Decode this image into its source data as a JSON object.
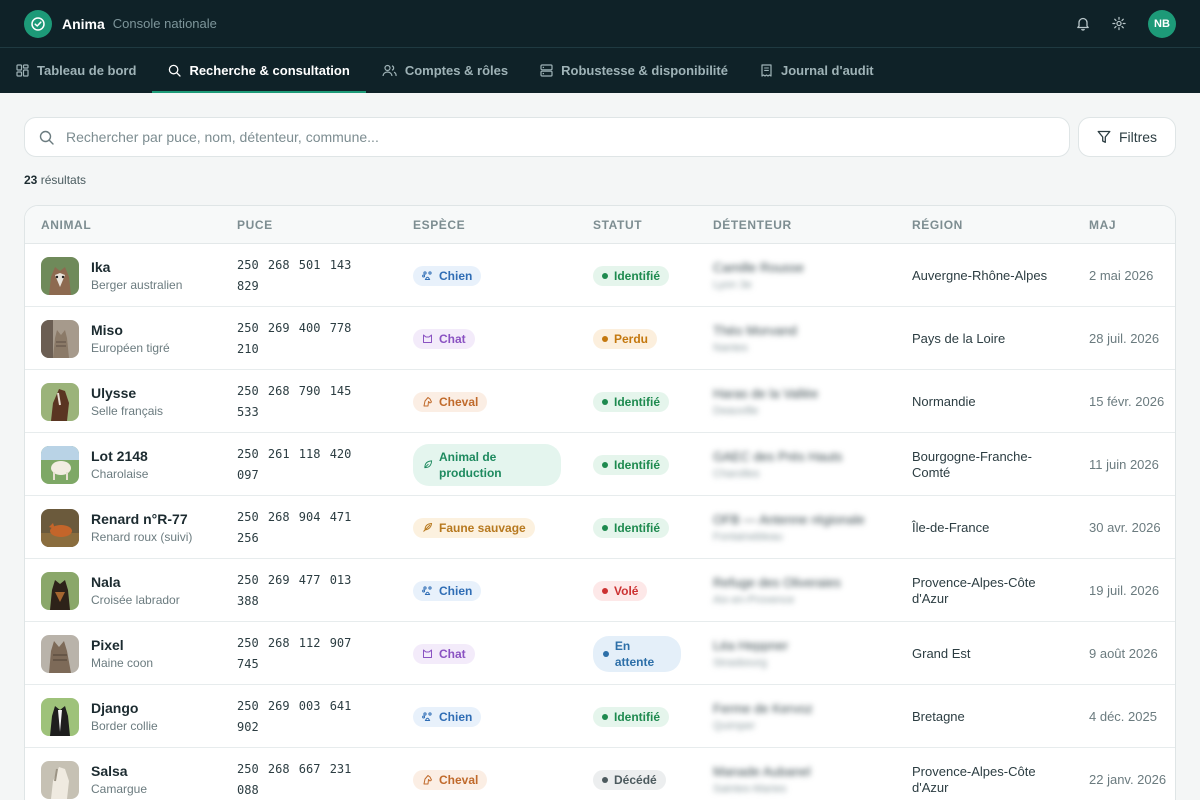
{
  "app": {
    "name": "Anima",
    "subtitle": "Console nationale",
    "user_initials": "NB"
  },
  "nav": {
    "tabs": [
      {
        "label": "Tableau de bord",
        "icon": "grid-icon",
        "active": false
      },
      {
        "label": "Recherche & consultation",
        "icon": "search-icon",
        "active": true
      },
      {
        "label": "Comptes & rôles",
        "icon": "users-icon",
        "active": false
      },
      {
        "label": "Robustesse & disponibilité",
        "icon": "server-icon",
        "active": false
      },
      {
        "label": "Journal d'audit",
        "icon": "receipt-icon",
        "active": false
      }
    ]
  },
  "search": {
    "placeholder": "Rechercher par puce, nom, détenteur, commune...",
    "value": ""
  },
  "filters_label": "Filtres",
  "results": {
    "count": "23",
    "label": "résultats"
  },
  "table": {
    "headers": [
      "ANIMAL",
      "PUCE",
      "ESPÈCE",
      "STATUT",
      "DÉTENTEUR",
      "RÉGION",
      "MAJ"
    ],
    "rows": [
      {
        "name": "Ika",
        "breed": "Berger australien",
        "puce1": "250 268 501 143",
        "puce2": "829",
        "espece": "Chien",
        "statut": "Identifié",
        "det1": "Camille Rousse",
        "det2": "Lyon 3e",
        "region": "Auvergne-Rhône-Alpes",
        "maj": "2 mai 2026"
      },
      {
        "name": "Miso",
        "breed": "Européen tigré",
        "puce1": "250 269 400 778",
        "puce2": "210",
        "espece": "Chat",
        "statut": "Perdu",
        "det1": "Théo Morvand",
        "det2": "Nantes",
        "region": "Pays de la Loire",
        "maj": "28 juil. 2026"
      },
      {
        "name": "Ulysse",
        "breed": "Selle français",
        "puce1": "250 268 790 145",
        "puce2": "533",
        "espece": "Cheval",
        "statut": "Identifié",
        "det1": "Haras de la Vallée",
        "det2": "Deauville",
        "region": "Normandie",
        "maj": "15 févr. 2026"
      },
      {
        "name": "Lot 2148",
        "breed": "Charolaise",
        "puce1": "250 261 118 420",
        "puce2": "097",
        "espece": "Animal de production",
        "statut": "Identifié",
        "det1": "GAEC des Prés Hauts",
        "det2": "Charolles",
        "region": "Bourgogne-Franche-Comté",
        "maj": "11 juin 2026"
      },
      {
        "name": "Renard n°R-77",
        "breed": "Renard roux (suivi)",
        "puce1": "250 268 904 471",
        "puce2": "256",
        "espece": "Faune sauvage",
        "statut": "Identifié",
        "det1": "OFB — Antenne régionale",
        "det2": "Fontainebleau",
        "region": "Île-de-France",
        "maj": "30 avr. 2026"
      },
      {
        "name": "Nala",
        "breed": "Croisée labrador",
        "puce1": "250 269 477 013",
        "puce2": "388",
        "espece": "Chien",
        "statut": "Volé",
        "det1": "Refuge des Oliveraies",
        "det2": "Aix-en-Provence",
        "region": "Provence-Alpes-Côte d'Azur",
        "maj": "19 juil. 2026"
      },
      {
        "name": "Pixel",
        "breed": "Maine coon",
        "puce1": "250 268 112 907",
        "puce2": "745",
        "espece": "Chat",
        "statut": "En attente",
        "det1": "Léa Heppner",
        "det2": "Strasbourg",
        "region": "Grand Est",
        "maj": "9 août 2026"
      },
      {
        "name": "Django",
        "breed": "Border collie",
        "puce1": "250 269 003 641",
        "puce2": "902",
        "espece": "Chien",
        "statut": "Identifié",
        "det1": "Ferme de Kervoz",
        "det2": "Quimper",
        "region": "Bretagne",
        "maj": "4 déc. 2025"
      },
      {
        "name": "Salsa",
        "breed": "Camargue",
        "puce1": "250 268 667 231",
        "puce2": "088",
        "espece": "Cheval",
        "statut": "Décédé",
        "det1": "Manade Aubanel",
        "det2": "Saintes-Maries",
        "region": "Provence-Alpes-Côte d'Azur",
        "maj": "22 janv. 2026"
      }
    ]
  },
  "colors": {
    "brand": "#1d9a78",
    "topbar": "#0f2228"
  }
}
